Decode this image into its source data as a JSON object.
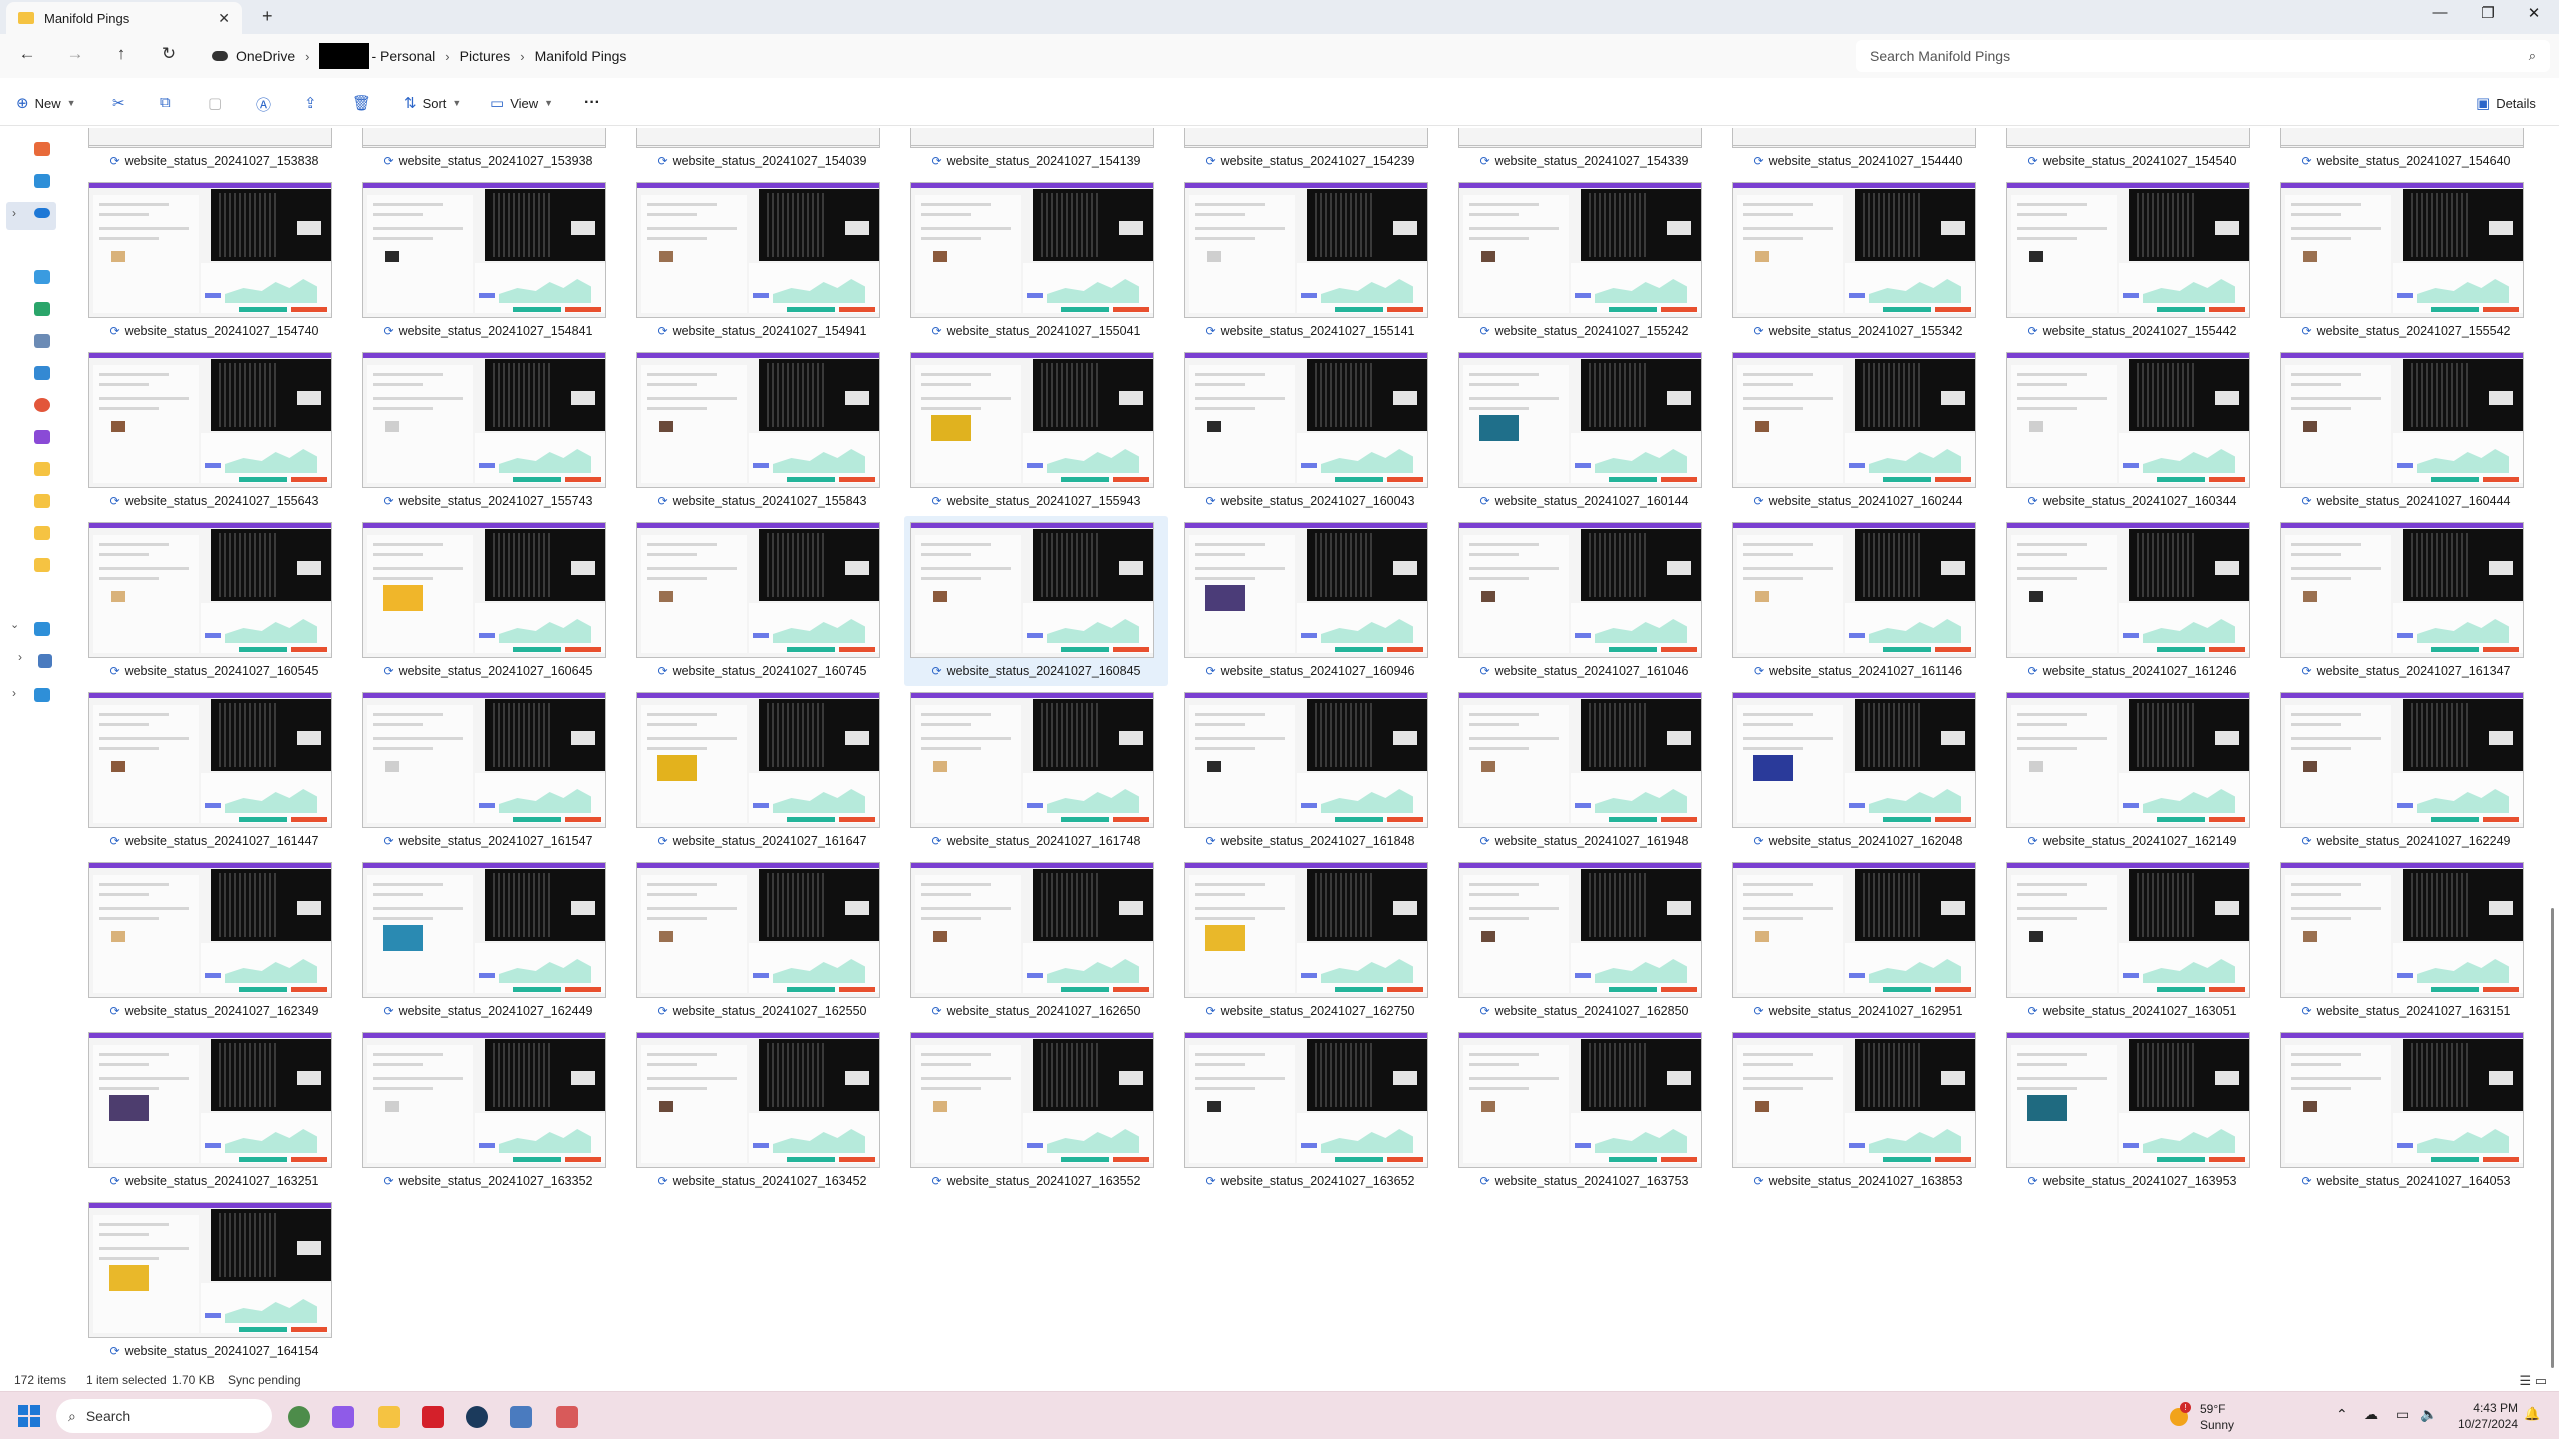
{
  "window": {
    "tab_title": "Manifold Pings",
    "minimize": "—",
    "restore": "❐",
    "close": "✕"
  },
  "address": {
    "crumbs": [
      "OneDrive",
      "- Personal",
      "Pictures",
      "Manifold Pings"
    ],
    "search_placeholder": "Search Manifold Pings"
  },
  "toolbar": {
    "new_label": "New",
    "sort_label": "Sort",
    "view_label": "View",
    "more_label": "···",
    "details_label": "Details"
  },
  "files": {
    "items": [
      "website_status_20241027_153838",
      "website_status_20241027_153938",
      "website_status_20241027_154039",
      "website_status_20241027_154139",
      "website_status_20241027_154239",
      "website_status_20241027_154339",
      "website_status_20241027_154440",
      "website_status_20241027_154540",
      "website_status_20241027_154640",
      "website_status_20241027_154740",
      "website_status_20241027_154841",
      "website_status_20241027_154941",
      "website_status_20241027_155041",
      "website_status_20241027_155141",
      "website_status_20241027_155242",
      "website_status_20241027_155342",
      "website_status_20241027_155442",
      "website_status_20241027_155542",
      "website_status_20241027_155643",
      "website_status_20241027_155743",
      "website_status_20241027_155843",
      "website_status_20241027_155943",
      "website_status_20241027_160043",
      "website_status_20241027_160144",
      "website_status_20241027_160244",
      "website_status_20241027_160344",
      "website_status_20241027_160444",
      "website_status_20241027_160545",
      "website_status_20241027_160645",
      "website_status_20241027_160745",
      "website_status_20241027_160845",
      "website_status_20241027_160946",
      "website_status_20241027_161046",
      "website_status_20241027_161146",
      "website_status_20241027_161246",
      "website_status_20241027_161347",
      "website_status_20241027_161447",
      "website_status_20241027_161547",
      "website_status_20241027_161647",
      "website_status_20241027_161748",
      "website_status_20241027_161848",
      "website_status_20241027_161948",
      "website_status_20241027_162048",
      "website_status_20241027_162149",
      "website_status_20241027_162249",
      "website_status_20241027_162349",
      "website_status_20241027_162449",
      "website_status_20241027_162550",
      "website_status_20241027_162650",
      "website_status_20241027_162750",
      "website_status_20241027_162850",
      "website_status_20241027_162951",
      "website_status_20241027_163051",
      "website_status_20241027_163151",
      "website_status_20241027_163251",
      "website_status_20241027_163352",
      "website_status_20241027_163452",
      "website_status_20241027_163552",
      "website_status_20241027_163652",
      "website_status_20241027_163753",
      "website_status_20241027_163853",
      "website_status_20241027_163953",
      "website_status_20241027_164053",
      "website_status_20241027_164154"
    ],
    "selected_name": "website_status_20241027_160845",
    "accents": {
      "website_status_20241027_155943": "#e0b21f",
      "website_status_20241027_160144": "#1f6f8a",
      "website_status_20241027_160645": "#f0b62a",
      "website_status_20241027_160946": "#4b3c78",
      "website_status_20241027_161647": "#e3b21d",
      "website_status_20241027_162048": "#2a3a9a",
      "website_status_20241027_162449": "#2a8ab2",
      "website_status_20241027_162750": "#e9b82a",
      "website_status_20241027_163251": "#4d3d6e",
      "website_status_20241027_163953": "#1f6a80",
      "website_status_20241027_164154": "#e9b82a"
    }
  },
  "status": {
    "count": "172 items",
    "selection": "1 item selected",
    "size": "1.70 KB",
    "sync": "Sync pending"
  },
  "taskbar": {
    "search_label": "Search",
    "weather_temp": "59°F",
    "weather_cond": "Sunny",
    "weather_alert": "!",
    "time": "4:43 PM",
    "date": "10/27/2024"
  },
  "colors": {
    "accent": "#2e67c9",
    "selection": "#e5f0fb",
    "taskbar": "#f1dfe6"
  }
}
